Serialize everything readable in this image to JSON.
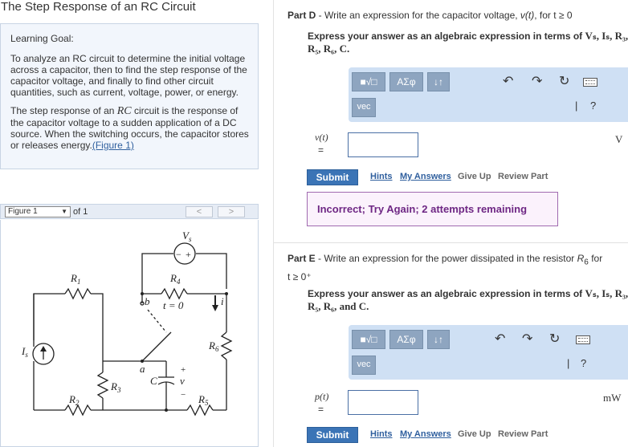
{
  "page_title": "The Step Response of an RC Circuit",
  "goal": {
    "title": "Learning Goal:",
    "p1": "To analyze an RC circuit to determine the initial voltage across a capacitor, then to find the step response of the capacitor voltage, and finally to find other circuit quantities, such as current, voltage, power, or energy.",
    "p2_a": "The step response of an ",
    "p2_rc": "RC",
    "p2_b": " circuit is the response of the capacitor voltage to a sudden application of a DC source. When the switching occurs, the capacitor stores or releases energy.",
    "p2_link": "(Figure 1)"
  },
  "figure_bar": {
    "select_value": "Figure 1",
    "of_text": "of 1",
    "prev": "<",
    "next": ">"
  },
  "circuit": {
    "vs": "V",
    "vs_sub": "s",
    "r1": "R",
    "r1_sub": "1",
    "r2": "R",
    "r2_sub": "2",
    "r3": "R",
    "r3_sub": "3",
    "r4": "R",
    "r4_sub": "4",
    "r5": "R",
    "r5_sub": "5",
    "r6": "R",
    "r6_sub": "6",
    "is": "I",
    "is_sub": "s",
    "c": "C",
    "v": "v",
    "i": "i",
    "a": "a",
    "b": "b",
    "t0": "t = 0",
    "plus": "+",
    "minus": "−"
  },
  "partD": {
    "head_bold": "Part D",
    "head_text": " - Write an expression for the capacitor voltage, ",
    "head_var": "v(t)",
    "head_tail": ", for t ≥ 0",
    "instr_1": "Express your answer as an algebraic expression in terms of ",
    "instr_syms1": "V",
    "instr_line2": "R₅, R₆, C.",
    "instr_syms_full": "Vₛ, Iₛ, R₃,",
    "var": "v(t)",
    "eq": "=",
    "units": "V",
    "feedback": "Incorrect; Try Again; 2 attempts remaining"
  },
  "partE": {
    "head_bold": "Part E",
    "head_text": " - Write an expression for the power dissipated in the resistor ",
    "head_var": "R",
    "head_sub": "6",
    "head_tail": " for",
    "head_line2": "t ≥ 0⁺",
    "instr_1": "Express your answer as an algebraic expression in terms of ",
    "instr_syms_full": "Vₛ, Iₛ, R₃,",
    "instr_line2": "R₅, R₆, and C.",
    "var": "p(t)",
    "eq": "=",
    "units": "mW"
  },
  "toolbar": {
    "sqrt_label": "■√□",
    "greek_label": "ΑΣφ",
    "arrows_label": "↓↑",
    "vec_label": "vec",
    "undo_icon": "undo-icon",
    "redo_icon": "redo-icon",
    "reset_icon": "reset-icon",
    "keyboard_icon": "keyboard-icon",
    "pipe": "|",
    "help": "?"
  },
  "actions": {
    "submit": "Submit",
    "hints": "Hints",
    "my_answers": "My Answers",
    "give_up": "Give Up",
    "review_part": "Review Part"
  },
  "colors": {
    "accent": "#3b74b6",
    "toolbar_bg": "#cfe0f4",
    "feedback_border": "#a06ab0",
    "feedback_text": "#6e2784"
  }
}
